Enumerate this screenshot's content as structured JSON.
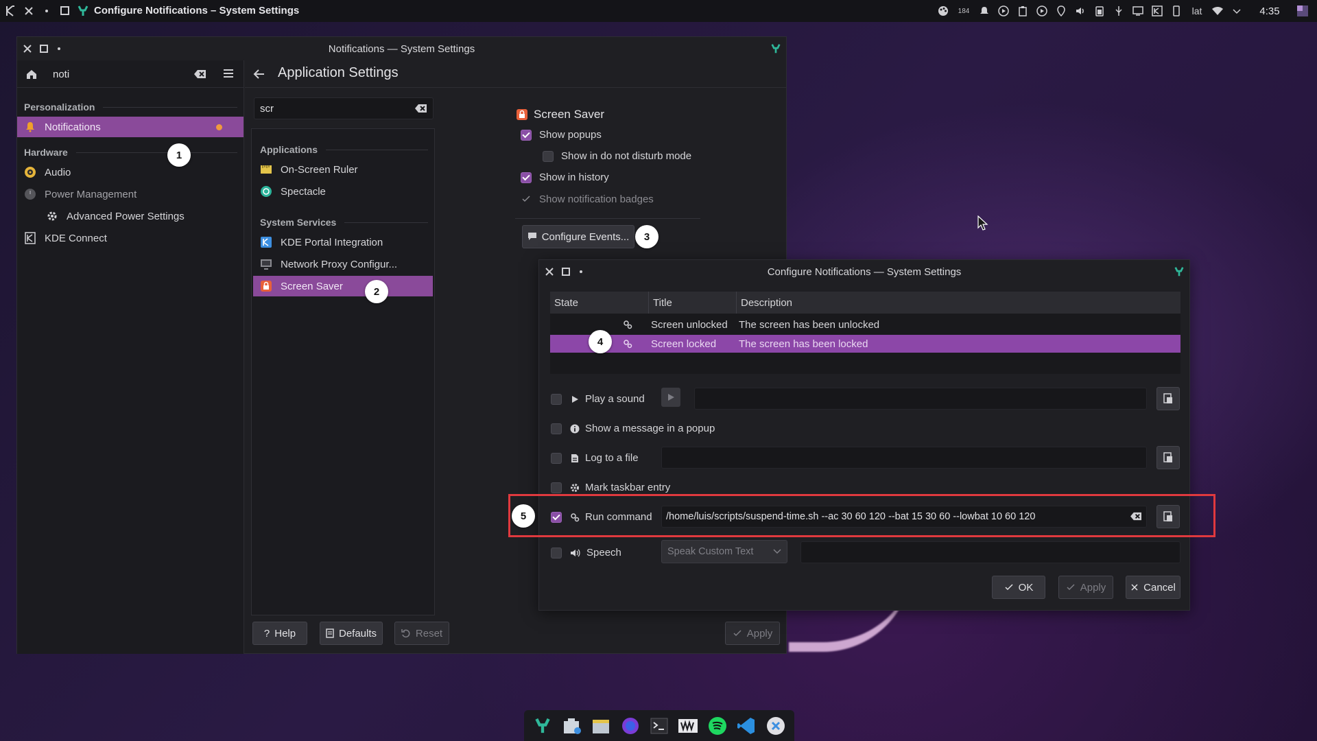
{
  "topbar": {
    "title": "Configure Notifications – System Settings",
    "clock": "4:35",
    "keyboard_layout": "lat",
    "battery_level": "184"
  },
  "settings_window": {
    "title": "Notifications — System Settings",
    "search_value": "noti",
    "page_title": "Application Settings",
    "sidebar": {
      "sections": [
        {
          "label": "Personalization"
        },
        {
          "label": "Hardware"
        }
      ],
      "items": [
        {
          "label": "Notifications",
          "selected": true,
          "icon": "bell-icon"
        },
        {
          "label": "Audio",
          "icon": "audio-icon"
        },
        {
          "label": "Power Management",
          "icon": "power-icon"
        },
        {
          "label": "Advanced Power Settings",
          "icon": "gear-icon"
        },
        {
          "label": "KDE Connect",
          "icon": "kde-connect-icon"
        }
      ]
    },
    "app_search_value": "scr",
    "app_list": {
      "groups": [
        {
          "label": "Applications"
        },
        {
          "label": "System Services"
        }
      ],
      "items": [
        {
          "label": "On-Screen Ruler",
          "icon": "ruler-icon"
        },
        {
          "label": "Spectacle",
          "icon": "spectacle-icon"
        },
        {
          "label": "KDE Portal Integration",
          "icon": "kde-portal-icon"
        },
        {
          "label": "Network Proxy Configur...",
          "icon": "network-proxy-icon"
        },
        {
          "label": "Screen Saver",
          "icon": "lock-icon",
          "selected": true
        }
      ]
    },
    "detail": {
      "app_name": "Screen Saver",
      "options": [
        {
          "label": "Show popups",
          "checked": true
        },
        {
          "label": "Show in do not disturb mode",
          "checked": false
        },
        {
          "label": "Show in history",
          "checked": true
        },
        {
          "label": "Show notification badges",
          "checked": true,
          "disabled": true
        }
      ],
      "configure_events_label": "Configure Events..."
    },
    "footer": {
      "help": "Help",
      "defaults": "Defaults",
      "reset": "Reset",
      "apply": "Apply"
    }
  },
  "dialog": {
    "title": "Configure Notifications — System Settings",
    "table": {
      "headers": [
        "State",
        "Title",
        "Description"
      ],
      "rows": [
        {
          "title": "Screen unlocked",
          "description": "The screen has been unlocked",
          "selected": false
        },
        {
          "title": "Screen locked",
          "description": "The screen has been locked",
          "selected": true
        }
      ]
    },
    "actions": {
      "play_sound": "Play a sound",
      "show_popup": "Show a message in a popup",
      "log_file": "Log to a file",
      "taskbar": "Mark taskbar entry",
      "run_command": "Run command",
      "run_command_value": "/home/luis/scripts/suspend-time.sh --ac 30 60 120 --bat 15 30 60 --lowbat 10 60 120",
      "speech": "Speech",
      "speech_option": "Speak Custom Text"
    },
    "buttons": {
      "ok": "OK",
      "apply": "Apply",
      "cancel": "Cancel"
    }
  },
  "annotations": {
    "b1": "1",
    "b2": "2",
    "b3": "3",
    "b4": "4",
    "b5": "5",
    "highlight_color": "#e0393e"
  },
  "colors": {
    "accent": "#8a4a9a",
    "selection_row": "#8c47a8"
  },
  "dock": [
    "system-settings-icon",
    "file-manager-icon",
    "files-icon",
    "firefox-icon",
    "terminal-icon",
    "vivaldi-icon",
    "spotify-icon",
    "vscode-icon",
    "discover-icon"
  ]
}
